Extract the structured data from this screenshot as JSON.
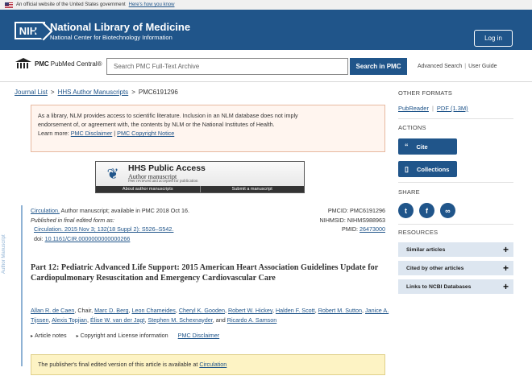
{
  "gov_banner": {
    "text": "An official website of the United States government",
    "link": "Here's how you know"
  },
  "header": {
    "logo": "NIH",
    "title": "National Library of Medicine",
    "subtitle": "National Center for Biotechnology Information",
    "login": "Log in"
  },
  "pmc_bar": {
    "logo_bold": "PMC",
    "logo_text": "PubMed Central®",
    "search_placeholder": "Search PMC Full-Text Archive",
    "search_button": "Search in PMC",
    "advanced_search": "Advanced Search",
    "user_guide": "User Guide"
  },
  "breadcrumb": [
    "Journal List",
    "HHS Author Manuscripts",
    "PMC6191296"
  ],
  "disclaimer": {
    "line1": "As a library, NLM provides access to scientific literature. Inclusion in an NLM database does not imply",
    "line2": "endorsement of, or agreement with, the contents by NLM or the National Institutes of Health.",
    "learn_more": "Learn more:",
    "link1": "PMC Disclaimer",
    "sep": "|",
    "link2": "PMC Copyright Notice"
  },
  "hhs_banner": {
    "title": "HHS Public Access",
    "subtitle": "Author manuscript",
    "subtitle2": "Peer reviewed and accepted for publication",
    "link1": "About author manuscripts",
    "link2": "Submit a manuscript"
  },
  "side_label": "Author Manuscript",
  "article": {
    "journal": "Circulation.",
    "journal_rest": " Author manuscript; available in PMC 2018 Oct 16.",
    "published_line": "Published in final edited form as:",
    "citation": "Circulation. 2015 Nov 3; 132(18 Suppl 2): S526–S542.",
    "doi_label": "doi: ",
    "doi": "10.1161/CIR.0000000000000266",
    "pmcid": "PMCID: PMC6191296",
    "nihmsid": "NIHMSID: NIHMS988963",
    "pmid_label": "PMID: ",
    "pmid": "26473000",
    "title": "Part 12: Pediatric Advanced Life Support: 2015 American Heart Association Guidelines Update for Cardiopulmonary Resuscitation and Emergency Cardiovascular Care",
    "authors": [
      {
        "name": "Allan R. de Caen",
        "role": ", Chair, "
      },
      {
        "name": "Marc D. Berg",
        "role": ", "
      },
      {
        "name": "Leon Chameides",
        "role": ", "
      },
      {
        "name": "Cheryl K. Gooden",
        "role": ", "
      },
      {
        "name": "Robert W. Hickey",
        "role": ", "
      },
      {
        "name": "Halden F. Scott",
        "role": ", "
      },
      {
        "name": "Robert M. Sutton",
        "role": ", "
      },
      {
        "name": "Janice A. Tijssen",
        "role": ", "
      },
      {
        "name": "Alexis Topjian",
        "role": ", "
      },
      {
        "name": "Élise W. van der Jagt",
        "role": ", "
      },
      {
        "name": "Stephen M. Schexnayder",
        "role": ", and "
      },
      {
        "name": "Ricardo A. Samson",
        "role": ""
      }
    ],
    "links": [
      "Article notes",
      "Copyright and License information",
      "PMC Disclaimer"
    ],
    "notice_text": "The publisher's final edited version of this article is available at ",
    "notice_link": "Circulation"
  },
  "sidebar": {
    "other_formats": "OTHER FORMATS",
    "pubreader": "PubReader",
    "sep": "|",
    "pdf": "PDF (1.3M)",
    "actions": "ACTIONS",
    "cite": "Cite",
    "collections": "Collections",
    "share": "SHARE",
    "resources": "RESOURCES",
    "resource_items": [
      "Similar articles",
      "Cited by other articles",
      "Links to NCBI Databases"
    ]
  },
  "colors": {
    "brand_blue": "#20558a",
    "disclaimer_bg": "#fff5ef",
    "notice_bg": "#fdf3c4",
    "resource_bg": "#dde6f0"
  }
}
